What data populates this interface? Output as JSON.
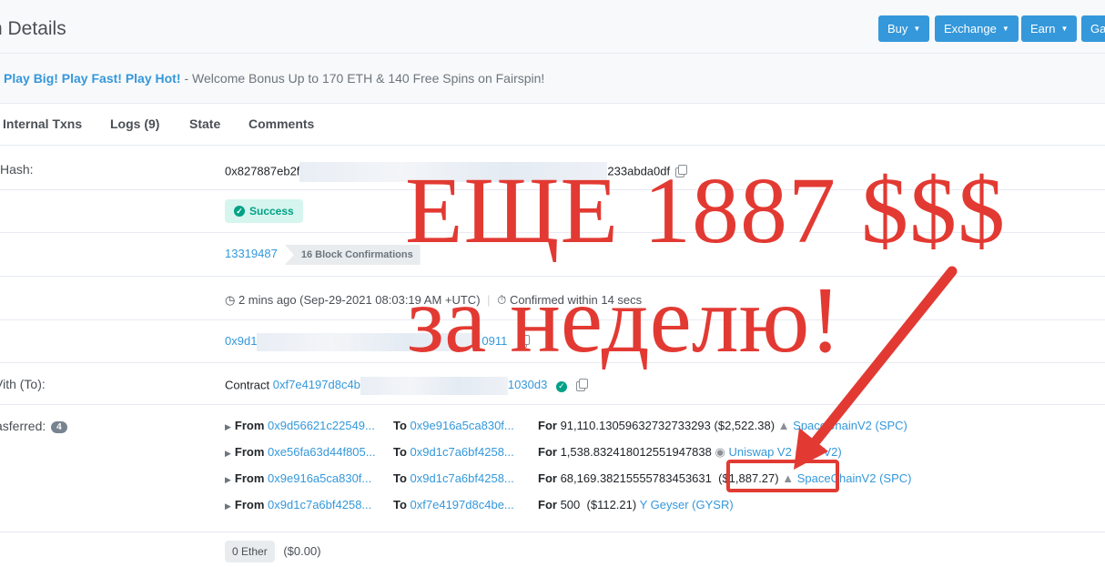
{
  "page_title": "n Details",
  "header_buttons": [
    {
      "label": "Buy"
    },
    {
      "label": "Exchange"
    },
    {
      "label": "Earn"
    },
    {
      "label": "Ga"
    }
  ],
  "promo": {
    "link": "Play Big! Play Fast! Play Hot!",
    "text": "- Welcome Bonus Up to 170 ETH & 140 Free Spins on Fairspin!"
  },
  "tabs": [
    "Internal Txns",
    "Logs (9)",
    "State",
    "Comments"
  ],
  "tx": {
    "hash_label": "Hash:",
    "hash_start": "0x827887eb2f",
    "hash_end": "233abda0df",
    "status": "Success",
    "block": "13319487",
    "confirmations": "16 Block Confirmations",
    "timestamp": "2 mins ago (Sep-29-2021 08:03:19 AM +UTC)",
    "separator": "|",
    "confirmed_within": "Confirmed within 14 secs",
    "from_start": "0x9d1",
    "from_end": "0911",
    "to_label": "Vith (To):",
    "to_prefix": "Contract",
    "to_start": "0xf7e4197d8c4b",
    "to_end": "1030d3",
    "tokens_label": "asferred:",
    "tokens_count": "4",
    "value": "0 Ether",
    "value_usd": "($0.00)"
  },
  "transfers": [
    {
      "from_label": "From",
      "from": "0x9d56621c22549...",
      "to_label": "To",
      "to": "0x9e916a5ca830f...",
      "for_label": "For",
      "amount": "91,110.13059632732733293",
      "usd": "($2,522.38)",
      "token": "SpaceChainV2 (SPC)",
      "icon": "spc-token-icon"
    },
    {
      "from_label": "From",
      "from": "0xe56fa63d44f805...",
      "to_label": "To",
      "to": "0x9d1c7a6bf4258...",
      "for_label": "For",
      "amount": "1,538.832418012551947838",
      "usd": "",
      "token": "Uniswap V2 (UNI-V2)",
      "icon": "uni-token-icon"
    },
    {
      "from_label": "From",
      "from": "0x9e916a5ca830f...",
      "to_label": "To",
      "to": "0x9d1c7a6bf4258...",
      "for_label": "For",
      "amount": "68,169.38215555783453631",
      "usd": "($1,887.27)",
      "token": "SpaceChainV2 (SPC)",
      "icon": "spc-token-icon"
    },
    {
      "from_label": "From",
      "from": "0x9d1c7a6bf4258...",
      "to_label": "To",
      "to": "0xf7e4197d8c4be...",
      "for_label": "For",
      "amount": "500",
      "usd": "($112.21)",
      "token": "Geyser (GYSR)",
      "icon": "gysr-token-icon"
    }
  ],
  "overlay": {
    "line1": "ЕЩЕ 1887 $$$",
    "line2": "за неделю!"
  },
  "colors": {
    "link": "#3498db",
    "overlay": "#e23a33",
    "success": "#00a186"
  }
}
